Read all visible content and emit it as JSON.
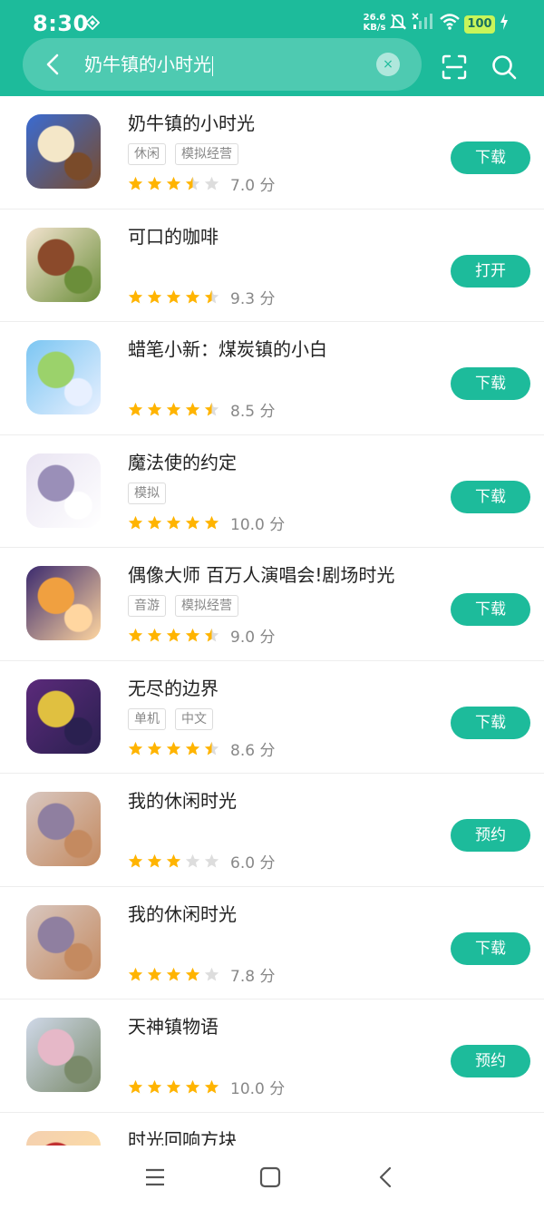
{
  "status": {
    "time": "8:30",
    "net_speed_value": "26.6",
    "net_speed_unit": "KB/s",
    "battery": "100"
  },
  "search": {
    "query": "奶牛镇的小时光",
    "clear_label": "×"
  },
  "colors": {
    "accent": "#1dbb9b",
    "star": "#ffb400",
    "star_empty": "#dddddd"
  },
  "apps": [
    {
      "title": "奶牛镇的小时光",
      "tags": [
        "休闲",
        "模拟经营"
      ],
      "stars": 3.5,
      "score": "7.0 分",
      "action": "下载"
    },
    {
      "title": "可口的咖啡",
      "tags": [],
      "stars": 4.5,
      "score": "9.3 分",
      "action": "打开"
    },
    {
      "title": "蜡笔小新：煤炭镇的小白",
      "tags": [],
      "stars": 4.5,
      "score": "8.5 分",
      "action": "下载"
    },
    {
      "title": "魔法使的约定",
      "tags": [
        "模拟"
      ],
      "stars": 5,
      "score": "10.0 分",
      "action": "下载"
    },
    {
      "title": "偶像大师 百万人演唱会!剧场时光",
      "tags": [
        "音游",
        "模拟经营"
      ],
      "stars": 4.5,
      "score": "9.0 分",
      "action": "下载"
    },
    {
      "title": "无尽的边界",
      "tags": [
        "单机",
        "中文"
      ],
      "stars": 4.5,
      "score": "8.6 分",
      "action": "下载"
    },
    {
      "title": "我的休闲时光",
      "tags": [],
      "stars": 3,
      "score": "6.0 分",
      "action": "预约"
    },
    {
      "title": "我的休闲时光",
      "tags": [],
      "stars": 4,
      "score": "7.8 分",
      "action": "下载"
    },
    {
      "title": "天神镇物语",
      "tags": [],
      "stars": 5,
      "score": "10.0 分",
      "action": "预约"
    },
    {
      "title": "时光回响方块",
      "tags": [],
      "stars": 0,
      "score": "",
      "action": ""
    }
  ],
  "icons": {
    "back": "chevron-left-icon",
    "scan": "scan-icon",
    "search": "search-icon",
    "nav_menu": "menu-icon",
    "nav_home": "home-icon",
    "nav_back": "back-icon"
  }
}
